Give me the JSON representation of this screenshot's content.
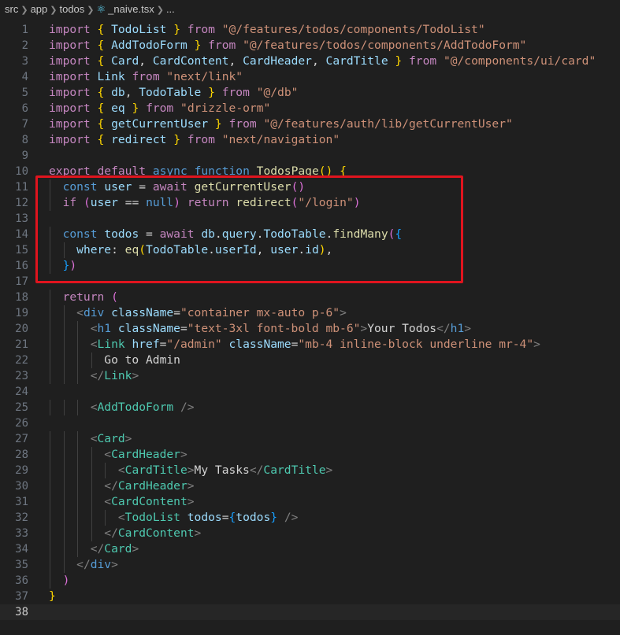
{
  "breadcrumb": {
    "segments": [
      "src",
      "app",
      "todos"
    ],
    "file_icon": "react-icon",
    "file_name": "_naive.tsx",
    "tail": "..."
  },
  "editor": {
    "current_line": 38,
    "highlight_color": "#e0141e",
    "lines": [
      {
        "n": "1",
        "html": "<span class='ctl'>import</span> <span class='br1'>{</span> <span class='var'>TodoList</span> <span class='br1'>}</span> <span class='ctl'>from</span> <span class='str'>\"@/features/todos/components/TodoList\"</span>"
      },
      {
        "n": "2",
        "html": "<span class='ctl'>import</span> <span class='br1'>{</span> <span class='var'>AddTodoForm</span> <span class='br1'>}</span> <span class='ctl'>from</span> <span class='str'>\"@/features/todos/components/AddTodoForm\"</span>"
      },
      {
        "n": "3",
        "html": "<span class='ctl'>import</span> <span class='br1'>{</span> <span class='var'>Card</span>, <span class='var'>CardContent</span>, <span class='var'>CardHeader</span>, <span class='var'>CardTitle</span> <span class='br1'>}</span> <span class='ctl'>from</span> <span class='str'>\"@/components/ui/card\"</span>"
      },
      {
        "n": "4",
        "html": "<span class='ctl'>import</span> <span class='var'>Link</span> <span class='ctl'>from</span> <span class='str'>\"next/link\"</span>"
      },
      {
        "n": "5",
        "html": "<span class='ctl'>import</span> <span class='br1'>{</span> <span class='var'>db</span>, <span class='var'>TodoTable</span> <span class='br1'>}</span> <span class='ctl'>from</span> <span class='str'>\"@/db\"</span>"
      },
      {
        "n": "6",
        "html": "<span class='ctl'>import</span> <span class='br1'>{</span> <span class='var'>eq</span> <span class='br1'>}</span> <span class='ctl'>from</span> <span class='str'>\"drizzle-orm\"</span>"
      },
      {
        "n": "7",
        "html": "<span class='ctl'>import</span> <span class='br1'>{</span> <span class='var'>getCurrentUser</span> <span class='br1'>}</span> <span class='ctl'>from</span> <span class='str'>\"@/features/auth/lib/getCurrentUser\"</span>"
      },
      {
        "n": "8",
        "html": "<span class='ctl'>import</span> <span class='br1'>{</span> <span class='var'>redirect</span> <span class='br1'>}</span> <span class='ctl'>from</span> <span class='str'>\"next/navigation\"</span>"
      },
      {
        "n": "9",
        "html": ""
      },
      {
        "n": "10",
        "html": "<span class='ctl'>export</span> <span class='ctl'>default</span> <span class='kw'>async</span> <span class='kw'>function</span> <span class='fn'>TodosPage</span><span class='br1'>()</span> <span class='br1'>{</span>"
      },
      {
        "n": "11",
        "html": "  <span class='kw'>const</span> <span class='var'>user</span> = <span class='ctl'>await</span> <span class='fn'>getCurrentUser</span><span class='br2'>()</span>"
      },
      {
        "n": "12",
        "html": "  <span class='ctl'>if</span> <span class='br2'>(</span><span class='var'>user</span> == <span class='kw'>null</span><span class='br2'>)</span> <span class='ctl'>return</span> <span class='fn'>redirect</span><span class='br2'>(</span><span class='str'>\"/login\"</span><span class='br2'>)</span>"
      },
      {
        "n": "13",
        "html": ""
      },
      {
        "n": "14",
        "html": "  <span class='kw'>const</span> <span class='var'>todos</span> = <span class='ctl'>await</span> <span class='var'>db</span>.<span class='var'>query</span>.<span class='var'>TodoTable</span>.<span class='fn'>findMany</span><span class='br2'>(</span><span class='br3'>{</span>"
      },
      {
        "n": "15",
        "html": "    <span class='var'>where</span>: <span class='fn'>eq</span><span class='br1'>(</span><span class='var'>TodoTable</span>.<span class='var'>userId</span>, <span class='var'>user</span>.<span class='var'>id</span><span class='br1'>)</span>,"
      },
      {
        "n": "16",
        "html": "  <span class='br3'>}</span><span class='br2'>)</span>"
      },
      {
        "n": "17",
        "html": ""
      },
      {
        "n": "18",
        "html": "  <span class='ctl'>return</span> <span class='br2'>(</span>"
      },
      {
        "n": "19",
        "html": "    <span class='tagp'>&lt;</span><span class='kw'>div</span> <span class='attr'>className</span>=<span class='str'>\"container mx-auto p-6\"</span><span class='tagp'>&gt;</span>"
      },
      {
        "n": "20",
        "html": "      <span class='tagp'>&lt;</span><span class='kw'>h1</span> <span class='attr'>className</span>=<span class='str'>\"text-3xl font-bold mb-6\"</span><span class='tagp'>&gt;</span>Your Todos<span class='tagp'>&lt;/</span><span class='kw'>h1</span><span class='tagp'>&gt;</span>"
      },
      {
        "n": "21",
        "html": "      <span class='tagp'>&lt;</span><span class='cls'>Link</span> <span class='attr'>href</span>=<span class='str'>\"/admin\"</span> <span class='attr'>className</span>=<span class='str'>\"mb-4 inline-block underline mr-4\"</span><span class='tagp'>&gt;</span>"
      },
      {
        "n": "22",
        "html": "        Go to Admin"
      },
      {
        "n": "23",
        "html": "      <span class='tagp'>&lt;/</span><span class='cls'>Link</span><span class='tagp'>&gt;</span>"
      },
      {
        "n": "24",
        "html": ""
      },
      {
        "n": "25",
        "html": "      <span class='tagp'>&lt;</span><span class='cls'>AddTodoForm</span> <span class='tagp'>/&gt;</span>"
      },
      {
        "n": "26",
        "html": ""
      },
      {
        "n": "27",
        "html": "      <span class='tagp'>&lt;</span><span class='cls'>Card</span><span class='tagp'>&gt;</span>"
      },
      {
        "n": "28",
        "html": "        <span class='tagp'>&lt;</span><span class='cls'>CardHeader</span><span class='tagp'>&gt;</span>"
      },
      {
        "n": "29",
        "html": "          <span class='tagp'>&lt;</span><span class='cls'>CardTitle</span><span class='tagp'>&gt;</span>My Tasks<span class='tagp'>&lt;/</span><span class='cls'>CardTitle</span><span class='tagp'>&gt;</span>"
      },
      {
        "n": "30",
        "html": "        <span class='tagp'>&lt;/</span><span class='cls'>CardHeader</span><span class='tagp'>&gt;</span>"
      },
      {
        "n": "31",
        "html": "        <span class='tagp'>&lt;</span><span class='cls'>CardContent</span><span class='tagp'>&gt;</span>"
      },
      {
        "n": "32",
        "html": "          <span class='tagp'>&lt;</span><span class='cls'>TodoList</span> <span class='attr'>todos</span>=<span class='br3'>{</span><span class='var'>todos</span><span class='br3'>}</span> <span class='tagp'>/&gt;</span>"
      },
      {
        "n": "33",
        "html": "        <span class='tagp'>&lt;/</span><span class='cls'>CardContent</span><span class='tagp'>&gt;</span>"
      },
      {
        "n": "34",
        "html": "      <span class='tagp'>&lt;/</span><span class='cls'>Card</span><span class='tagp'>&gt;</span>"
      },
      {
        "n": "35",
        "html": "    <span class='tagp'>&lt;/</span><span class='kw'>div</span><span class='tagp'>&gt;</span>"
      },
      {
        "n": "36",
        "html": "  <span class='br2'>)</span>"
      },
      {
        "n": "37",
        "html": "<span class='br1'>}</span>"
      },
      {
        "n": "38",
        "html": ""
      }
    ]
  }
}
